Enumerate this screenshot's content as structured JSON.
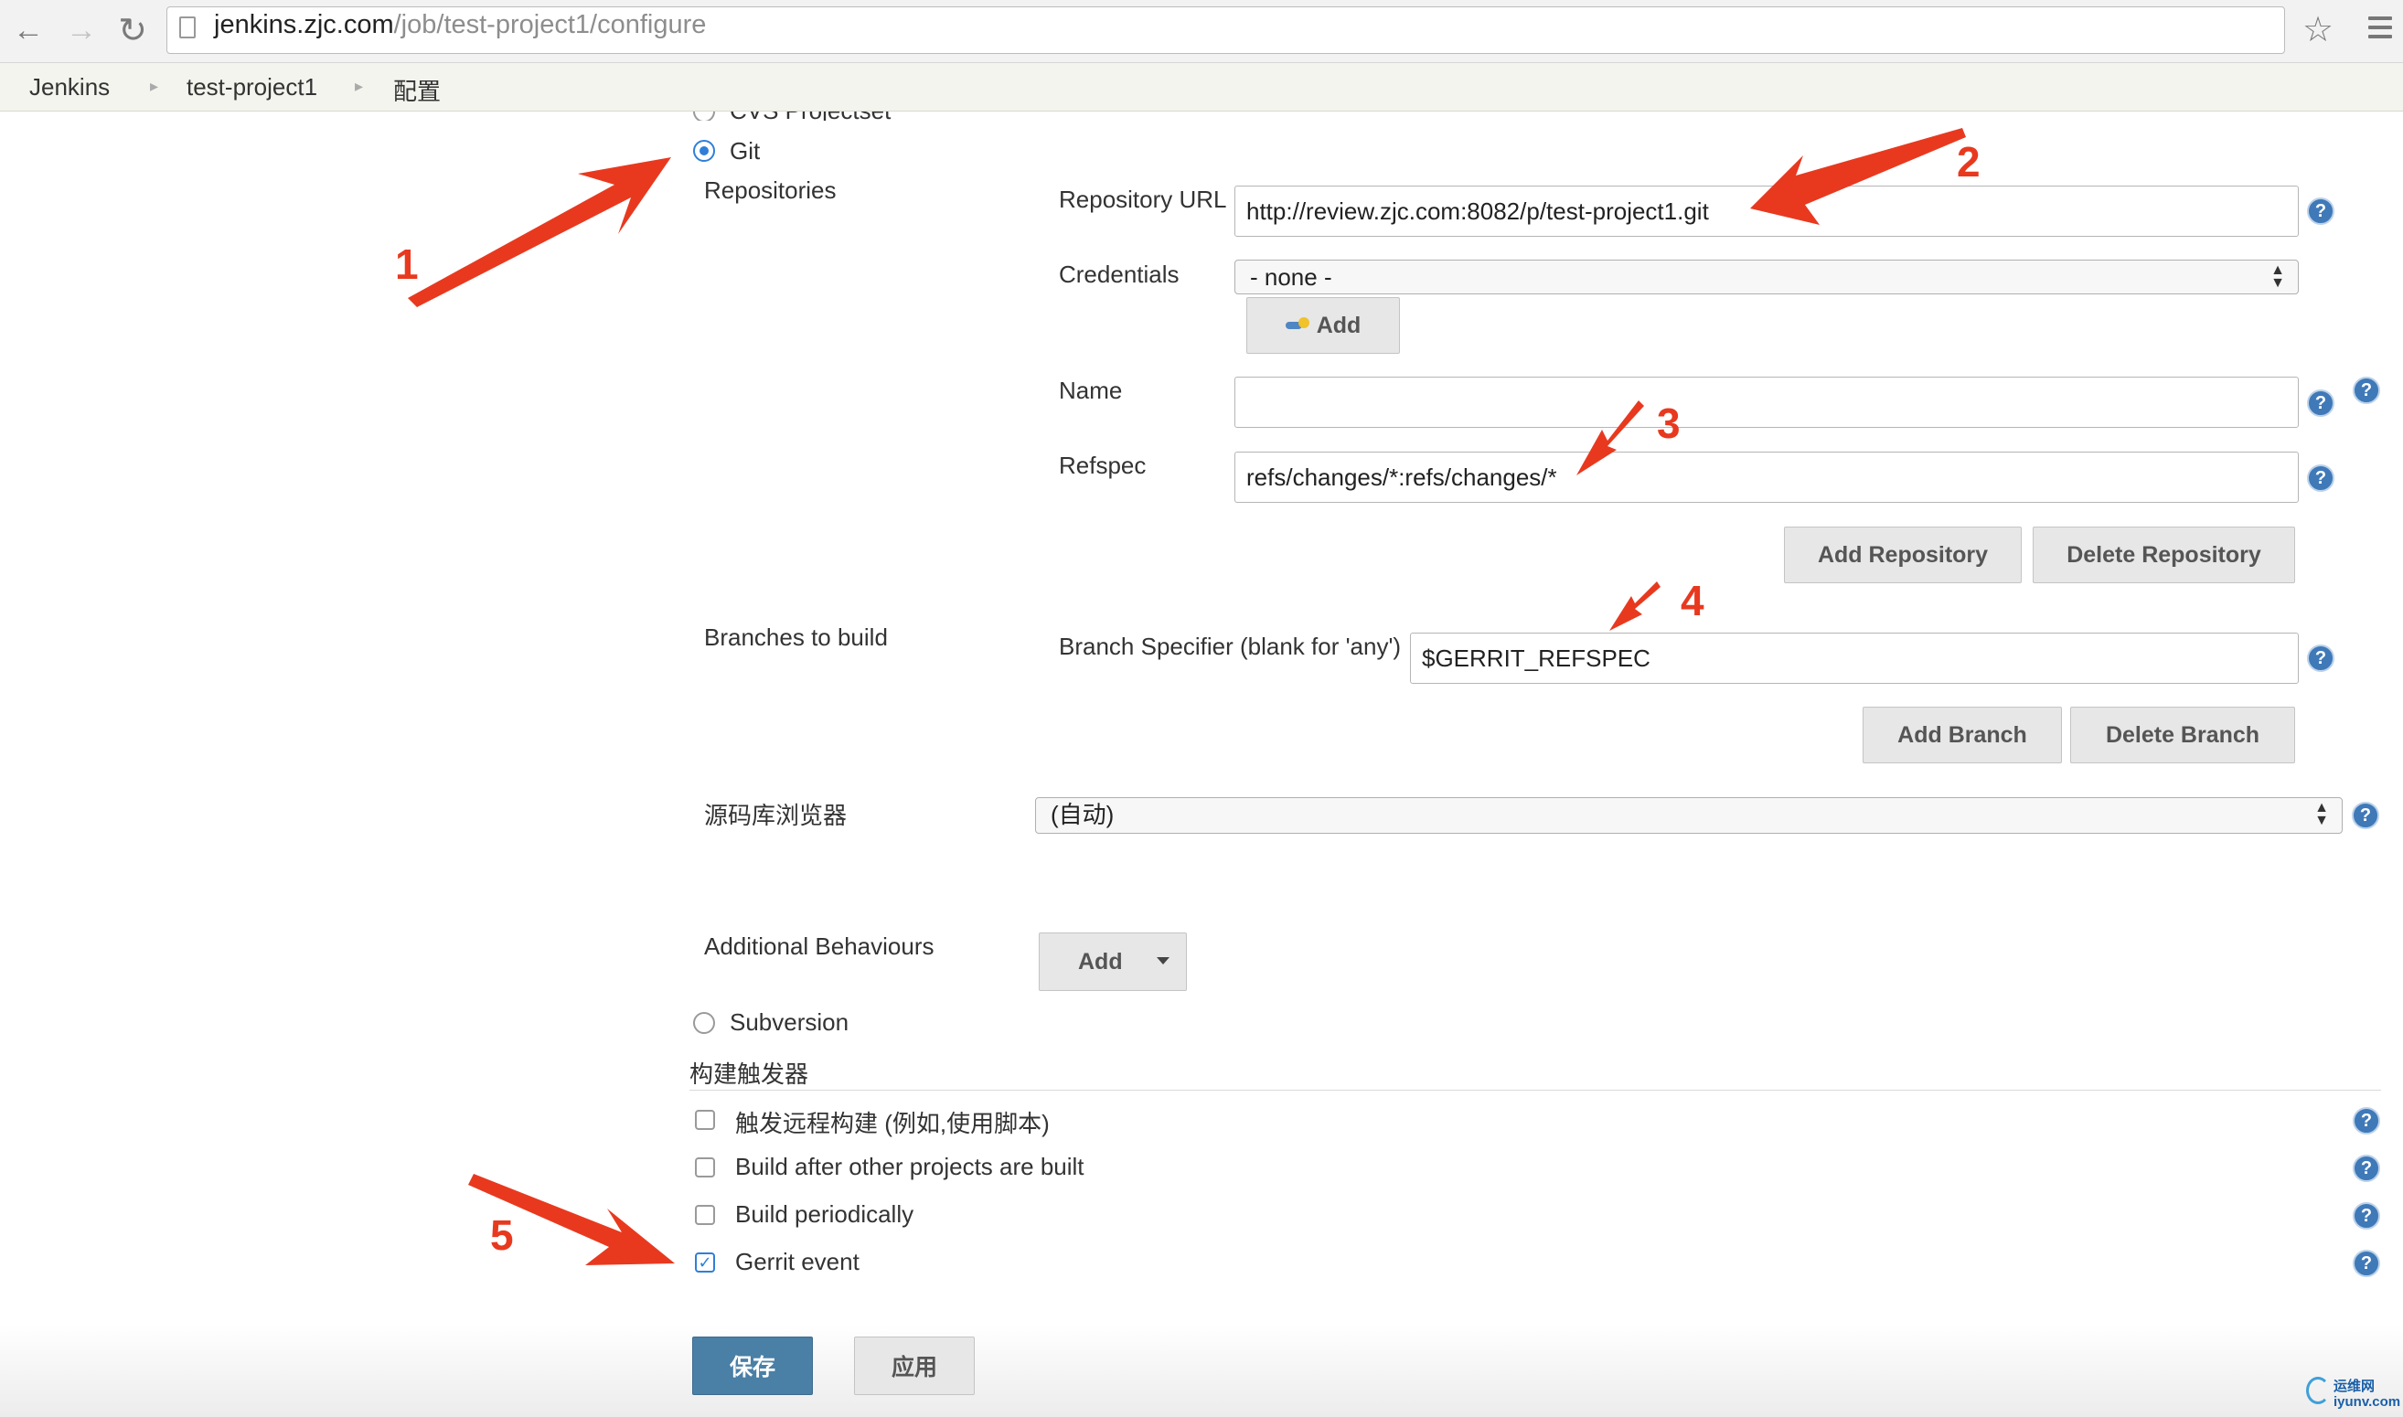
{
  "browser": {
    "url_host": "jenkins.zjc.com",
    "url_path": "/job/test-project1/configure"
  },
  "breadcrumb": [
    "Jenkins",
    "test-project1",
    "配置"
  ],
  "scm": {
    "cut_option": "CVS Projectset",
    "git_label": "Git",
    "repositories_label": "Repositories",
    "repository_url_label": "Repository URL",
    "repository_url_value": "http://review.zjc.com:8082/p/test-project1.git",
    "credentials_label": "Credentials",
    "credentials_value": "- none -",
    "credentials_add": "Add",
    "name_label": "Name",
    "name_value": "",
    "refspec_label": "Refspec",
    "refspec_value": "refs/changes/*:refs/changes/*",
    "add_repository": "Add Repository",
    "delete_repository": "Delete Repository",
    "branches_label": "Branches to build",
    "branch_specifier_label": "Branch Specifier (blank for 'any')",
    "branch_specifier_value": "$GERRIT_REFSPEC",
    "add_branch": "Add Branch",
    "delete_branch": "Delete Branch",
    "browser_label": "源码库浏览器",
    "browser_value": "(自动)",
    "additional_label": "Additional Behaviours",
    "additional_add": "Add",
    "subversion_label": "Subversion"
  },
  "triggers": {
    "title": "构建触发器",
    "items": [
      {
        "label": "触发远程构建 (例如,使用脚本)",
        "checked": false
      },
      {
        "label": "Build after other projects are built",
        "checked": false
      },
      {
        "label": "Build periodically",
        "checked": false
      },
      {
        "label": "Gerrit event",
        "checked": true
      }
    ]
  },
  "actions": {
    "save": "保存",
    "apply": "应用"
  },
  "annotations": [
    "1",
    "2",
    "3",
    "4",
    "5"
  ],
  "watermark": {
    "line1": "运维网",
    "line2": "iyunv.com"
  },
  "colors": {
    "accent": "#2f7fd8",
    "annotation": "#e8391f",
    "save_button": "#4a7fa6",
    "help_icon": "#3f79b8"
  }
}
